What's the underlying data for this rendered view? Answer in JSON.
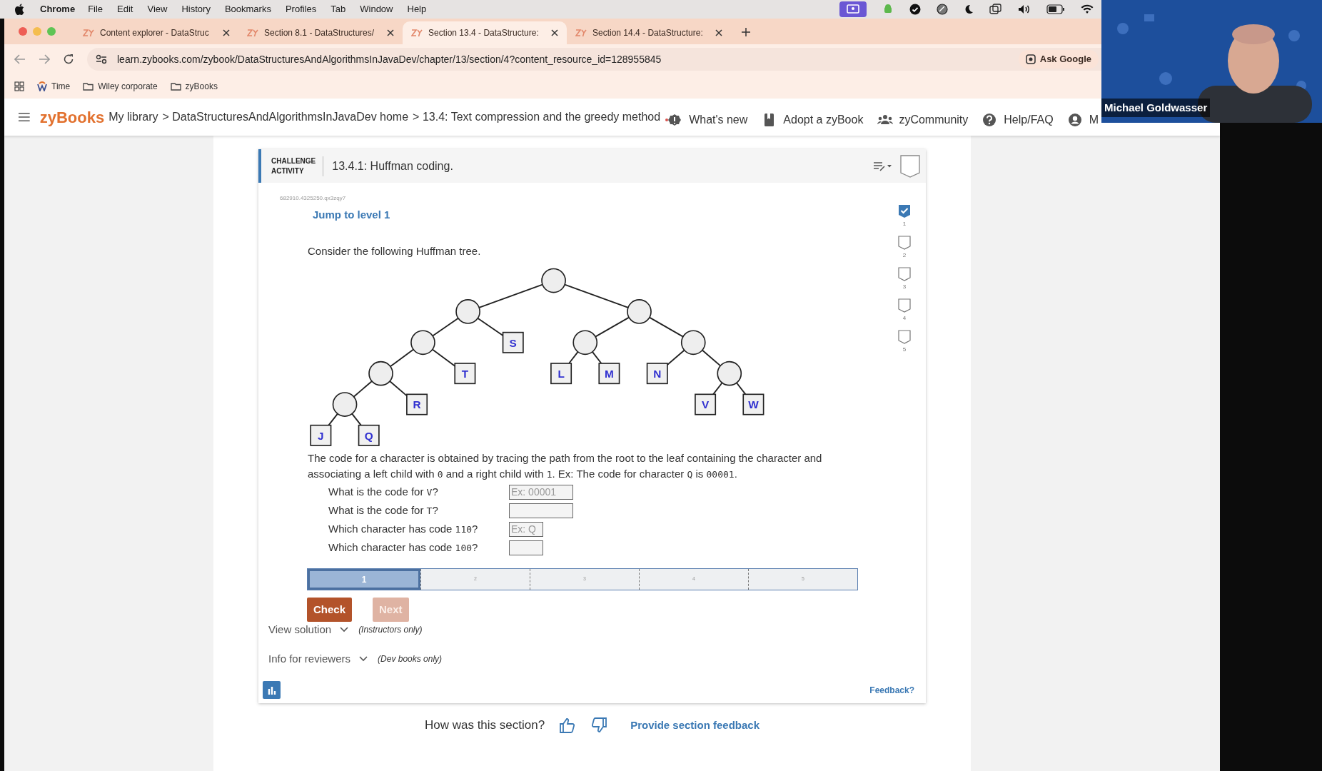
{
  "menu_bar": {
    "app": "Chrome",
    "items": [
      "File",
      "Edit",
      "View",
      "History",
      "Bookmarks",
      "Profiles",
      "Tab",
      "Window",
      "Help"
    ]
  },
  "tabs": [
    {
      "label": "Content explorer - DataStruc",
      "selected": false
    },
    {
      "label": "Section 8.1 - DataStructures/",
      "selected": false
    },
    {
      "label": "Section 13.4 - DataStructure:",
      "selected": true
    },
    {
      "label": "Section 14.4 - DataStructure:",
      "selected": false
    }
  ],
  "address_bar": {
    "url": "learn.zybooks.com/zybook/DataStructuresAndAlgorithmsInJavaDev/chapter/13/section/4?content_resource_id=128955845",
    "ask_button": "Ask Google"
  },
  "bookmarks": [
    {
      "label": "Time",
      "kind": "site"
    },
    {
      "label": "Wiley corporate",
      "kind": "folder"
    },
    {
      "label": "zyBooks",
      "kind": "folder"
    }
  ],
  "site_nav": {
    "logo": "zyBooks",
    "breadcrumbs": [
      "My library",
      "> DataStructuresAndAlgorithmsInJavaDev home",
      "> 13.4: Text compression and the greedy method"
    ],
    "links": [
      "What's new",
      "Adopt a zyBook",
      "zyCommunity",
      "Help/FAQ",
      "M"
    ]
  },
  "activity": {
    "label_lines": [
      "CHALLENGE",
      "ACTIVITY"
    ],
    "title": "13.4.1: Huffman coding.",
    "id": "682910.4325250.qx3zqy7",
    "jump": "Jump to level 1",
    "prompt": "Consider the following Huffman tree.",
    "tree": {
      "children": [
        {
          "children": [
            {
              "children": [
                {
                  "children": [
                    {
                      "children": [
                        {
                          "label": "J"
                        },
                        {
                          "label": "Q"
                        }
                      ]
                    },
                    {
                      "label": "R"
                    }
                  ]
                },
                {
                  "label": "T"
                }
              ]
            },
            {
              "label": "S"
            }
          ]
        },
        {
          "children": [
            {
              "children": [
                {
                  "label": "L"
                },
                {
                  "label": "M"
                }
              ]
            },
            {
              "children": [
                {
                  "label": "N"
                },
                {
                  "children": [
                    {
                      "label": "V"
                    },
                    {
                      "label": "W"
                    }
                  ]
                }
              ]
            }
          ]
        }
      ]
    },
    "explanation": [
      {
        "text": "The code for a character is obtained by tracing the path from the root to the leaf containing the character and associating a left child with "
      },
      {
        "text": "0",
        "code": true
      },
      {
        "text": " and a right child with "
      },
      {
        "text": "1",
        "code": true
      },
      {
        "text": ". Ex: The code for character "
      },
      {
        "text": "Q",
        "code": true
      },
      {
        "text": " is "
      },
      {
        "text": "00001",
        "code": true
      },
      {
        "text": "."
      }
    ],
    "questions": [
      {
        "kind": "code",
        "parts": [
          {
            "text": "What is the code for "
          },
          {
            "text": "V",
            "code": true
          },
          {
            "text": "?"
          }
        ],
        "placeholder": "Ex: 00001"
      },
      {
        "kind": "code",
        "parts": [
          {
            "text": "What is the code for "
          },
          {
            "text": "T",
            "code": true
          },
          {
            "text": "?"
          }
        ]
      },
      {
        "kind": "character",
        "parts": [
          {
            "text": "Which character has code "
          },
          {
            "text": "110",
            "code": true
          },
          {
            "text": "?"
          }
        ],
        "placeholder": "Ex: Q"
      },
      {
        "kind": "character",
        "parts": [
          {
            "text": "Which character has code "
          },
          {
            "text": "100",
            "code": true
          },
          {
            "text": "?"
          }
        ]
      }
    ],
    "progress": [
      {
        "label": "1",
        "selected": true
      },
      {
        "label": "2",
        "selected": false
      },
      {
        "label": "3",
        "selected": false
      },
      {
        "label": "4",
        "selected": false
      },
      {
        "label": "5",
        "selected": false
      }
    ],
    "buttons": [
      {
        "label": "Check",
        "disabled": false
      },
      {
        "label": "Next",
        "disabled": true
      }
    ],
    "levels": [
      {
        "label": "1",
        "checked": true
      },
      {
        "label": "2",
        "checked": false
      },
      {
        "label": "3",
        "checked": false
      },
      {
        "label": "4",
        "checked": false
      },
      {
        "label": "5",
        "checked": false
      }
    ],
    "expanders": [
      {
        "label": "View solution",
        "note": "(Instructors only)"
      },
      {
        "label": "Info for reviewers",
        "note": "(Dev books only)"
      }
    ],
    "feedback_link": "Feedback?"
  },
  "section_feedback": {
    "question": "How was this section?",
    "link": "Provide section feedback"
  },
  "video": {
    "name": "Michael Goldwasser"
  }
}
